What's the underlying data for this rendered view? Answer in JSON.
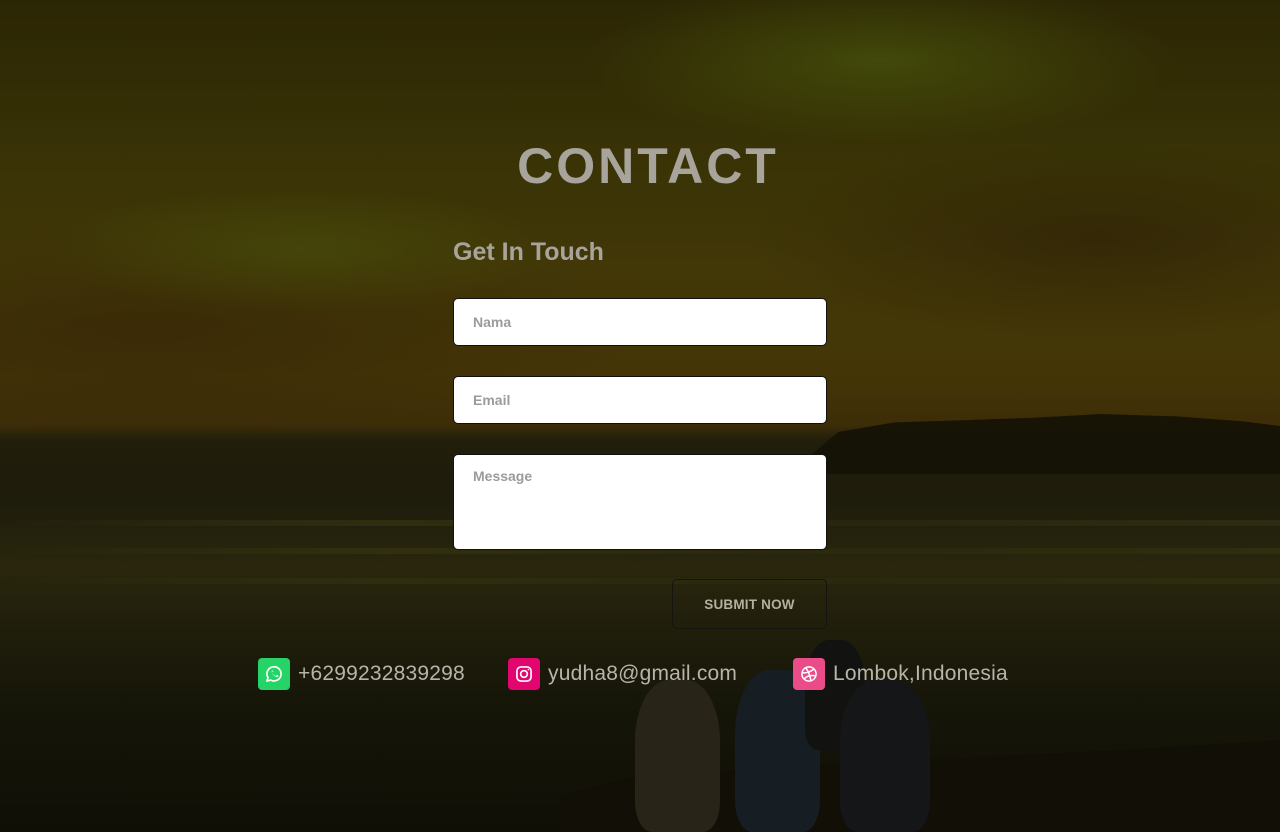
{
  "page": {
    "title": "CONTACT",
    "subtitle": "Get In Touch"
  },
  "form": {
    "name_placeholder": "Nama",
    "email_placeholder": "Email",
    "message_placeholder": "Message",
    "submit_label": "SUBMIT NOW"
  },
  "contacts": {
    "phone": {
      "icon": "whatsapp-icon",
      "text": "+6299232839298",
      "color": "#25d366"
    },
    "email": {
      "icon": "instagram-icon",
      "text": "yudha8@gmail.com",
      "color": "#e1066f"
    },
    "location": {
      "icon": "dribbble-icon",
      "text": "Lombok,Indonesia",
      "color": "#ea4c89"
    }
  },
  "colors": {
    "heading": "#a8a49c",
    "overlay_tint": "#5b4d0a"
  }
}
